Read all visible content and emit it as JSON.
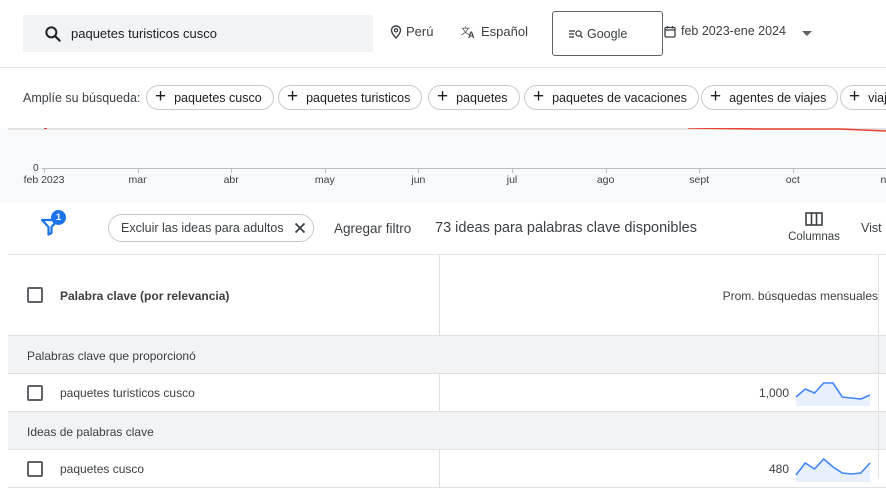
{
  "search": {
    "query": "paquetes turisticos cusco"
  },
  "location": {
    "label": "Perú"
  },
  "language": {
    "label": "Español"
  },
  "network": {
    "label": "Google"
  },
  "date_range": {
    "label": "feb 2023-ene 2024"
  },
  "broaden": {
    "label": "Amplíe su búsqueda:",
    "chips": [
      "paquetes cusco",
      "paquetes turisticos",
      "paquetes",
      "paquetes de vacaciones",
      "agentes de viajes",
      "viaj"
    ]
  },
  "chart_data": {
    "type": "line",
    "y_min_label": "0",
    "x_ticks": [
      "feb 2023",
      "mar",
      "abr",
      "may",
      "jun",
      "jul",
      "ago",
      "sept",
      "oct",
      "no"
    ]
  },
  "filters": {
    "badge_count": "1",
    "adult_chip": "Excluir las ideas para adultos",
    "add_filter": "Agregar filtro",
    "ideas_count": "73 ideas para palabras clave disponibles",
    "columns": "Columnas",
    "view": "Vist"
  },
  "table": {
    "col_keyword": "Palabra clave (por relevancia)",
    "col_avg": "Prom. búsquedas mensuales",
    "section_provided": "Palabras clave que proporcionó",
    "section_ideas": "Ideas de palabras clave",
    "rows": [
      {
        "keyword": "paquetes turisticos cusco",
        "avg": "1,000",
        "trend": [
          0.3,
          0.7,
          0.5,
          1.0,
          1.0,
          0.3,
          0.25,
          0.2,
          0.4
        ]
      },
      {
        "keyword": "paquetes cusco",
        "avg": "480",
        "trend": [
          0.2,
          0.8,
          0.5,
          1.0,
          0.6,
          0.3,
          0.25,
          0.3,
          0.8
        ]
      }
    ]
  },
  "colors": {
    "accent": "#1a73e8",
    "spark": "#4285f4",
    "trend_red": "#ea4335"
  }
}
